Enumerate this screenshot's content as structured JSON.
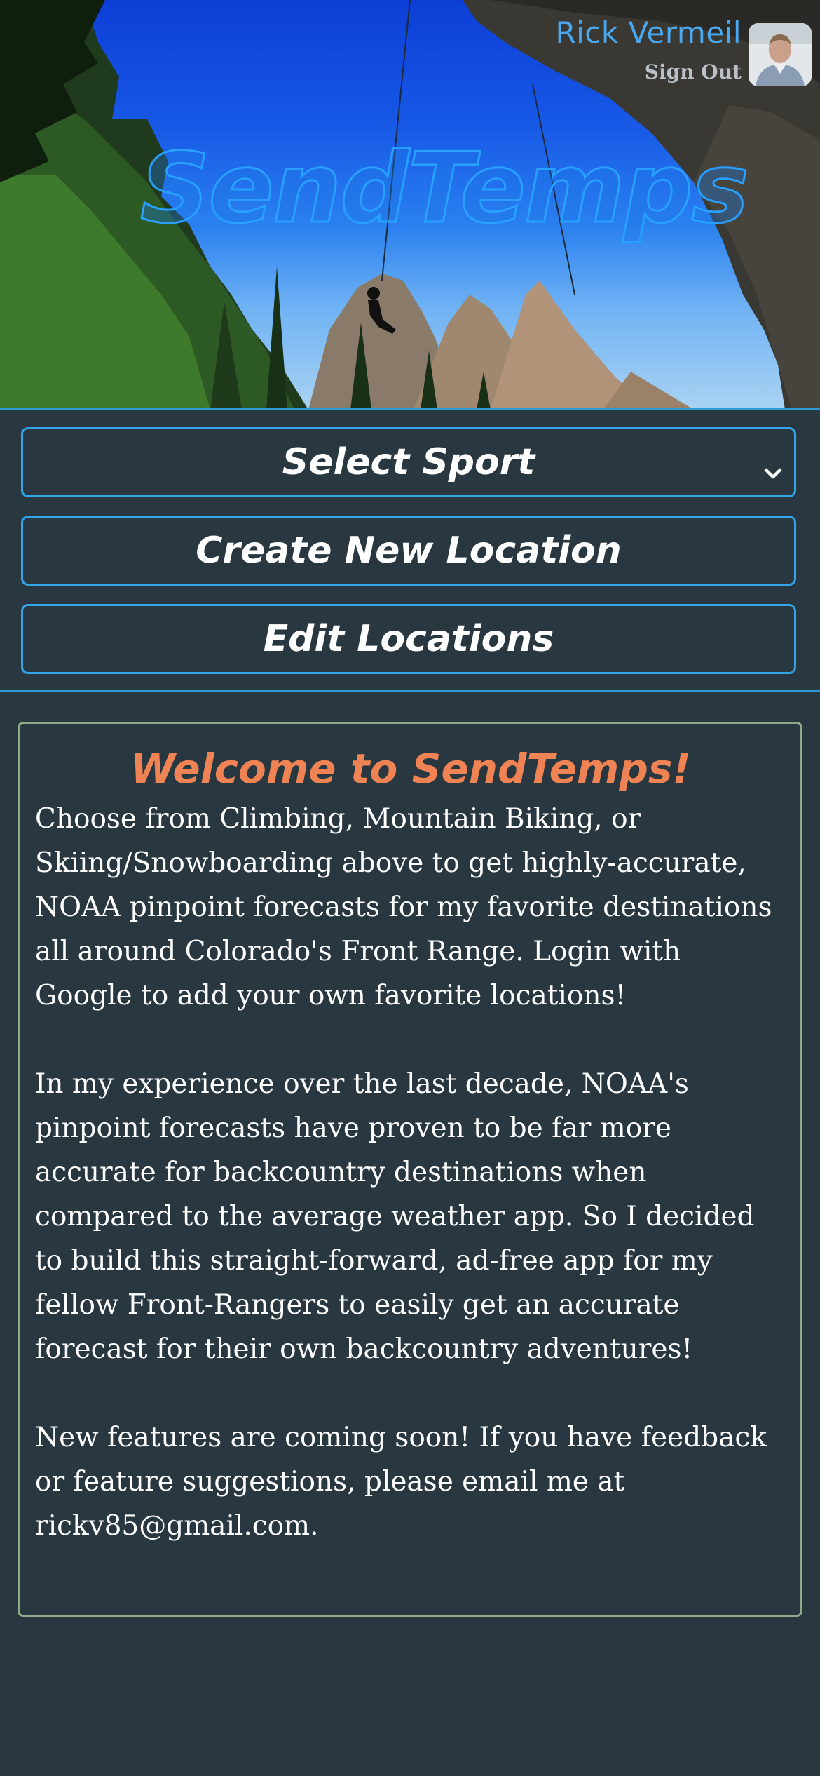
{
  "app": {
    "logo_text": "SendTemps"
  },
  "header": {
    "user_name": "Rick Vermeil",
    "sign_out_label": "Sign Out"
  },
  "controls": {
    "select_sport_label": "Select Sport",
    "create_location_label": "Create New Location",
    "edit_locations_label": "Edit Locations"
  },
  "welcome": {
    "title": "Welcome to SendTemps!",
    "paragraphs": [
      "Choose from Climbing, Mountain Biking, or Skiing/Snowboarding above to get highly-accurate, NOAA pinpoint forecasts for my favorite destinations all around Colorado's Front Range. Login with Google to add your own favorite locations!",
      "In my experience over the last decade, NOAA's pinpoint forecasts have proven to be far more accurate for backcountry destinations when compared to the average weather app. So I decided to build this straight-forward, ad-free app for my fellow Front-Rangers to easily get an accurate forecast for their own backcountry adventures!",
      "New features are coming soon! If you have feedback or feature suggestions, please email me at rickv85@gmail.com."
    ]
  },
  "colors": {
    "background": "#283740",
    "accent_blue": "#33a4ea",
    "title_orange": "#ef8354",
    "card_border": "#8faa86"
  },
  "icons": {
    "select_chevron": "chevron-down-icon"
  }
}
